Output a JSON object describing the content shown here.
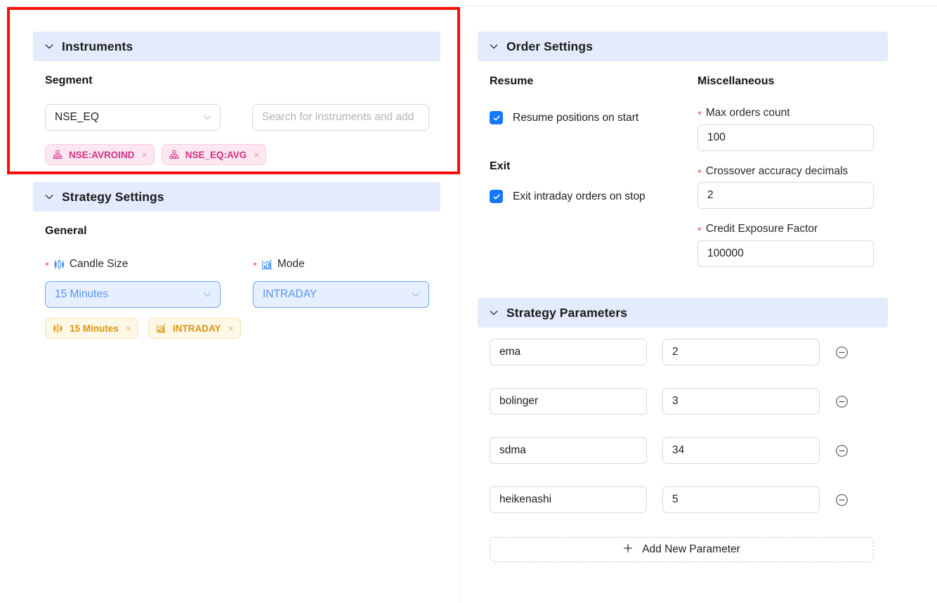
{
  "sections": {
    "instruments": {
      "title": "Instruments",
      "collapse_icon": "chevron-down-icon",
      "segment_label": "Segment",
      "segment_value": "NSE_EQ",
      "search_placeholder": "Search for instruments and add",
      "chips": [
        {
          "label": "NSE:AVROIND",
          "icon": "sitemap-icon",
          "remove": "×"
        },
        {
          "label": "NSE_EQ:AVG",
          "icon": "sitemap-icon",
          "remove": "×"
        }
      ]
    },
    "strategy_settings": {
      "title": "Strategy Settings",
      "collapse_icon": "chevron-down-icon",
      "general_label": "General",
      "candle_size_label": "Candle Size",
      "candle_size_icon": "candlestick-chart-icon",
      "candle_size_value": "15 Minutes",
      "candle_size_required": "*",
      "mode_label": "Mode",
      "mode_icon": "bar-chart-trend-icon",
      "mode_value": "INTRADAY",
      "mode_required": "*",
      "chips": [
        {
          "label": "15 Minutes",
          "icon": "candlestick-chart-icon",
          "remove": "×"
        },
        {
          "label": "INTRADAY",
          "icon": "bar-chart-trend-icon",
          "remove": "×"
        }
      ]
    },
    "order_settings": {
      "title": "Order Settings",
      "collapse_icon": "chevron-down-icon",
      "resume_group": "Resume",
      "resume_checkbox_label": "Resume positions on start",
      "resume_checked": true,
      "exit_group": "Exit",
      "exit_checkbox_label": "Exit intraday orders on stop",
      "exit_checked": true,
      "misc_group": "Miscellaneous",
      "fields": [
        {
          "label": "Max orders count",
          "value": "100",
          "required": "*"
        },
        {
          "label": "Crossover accuracy decimals",
          "value": "2",
          "required": "*"
        },
        {
          "label": "Credit Exposure Factor",
          "value": "100000",
          "required": "*"
        }
      ]
    },
    "strategy_parameters": {
      "title": "Strategy Parameters",
      "collapse_icon": "chevron-down-icon",
      "rows": [
        {
          "name": "ema",
          "value": "2",
          "remove_icon": "minus-circle-icon"
        },
        {
          "name": "bolinger",
          "value": "3",
          "remove_icon": "minus-circle-icon"
        },
        {
          "name": "sdma",
          "value": "34",
          "remove_icon": "minus-circle-icon"
        },
        {
          "name": "heikenashi",
          "value": "5",
          "remove_icon": "minus-circle-icon"
        }
      ],
      "add_button_label": "Add New Parameter",
      "add_button_icon": "plus-icon"
    }
  },
  "colors": {
    "section_header_bg": "#e3ebfd",
    "annotation_red": "#fc0d08",
    "accent_blue": "#1677ff",
    "chip_pink_text": "#d62f86",
    "chip_yellow_text": "#d99413",
    "required_star": "#ff4d4f"
  }
}
